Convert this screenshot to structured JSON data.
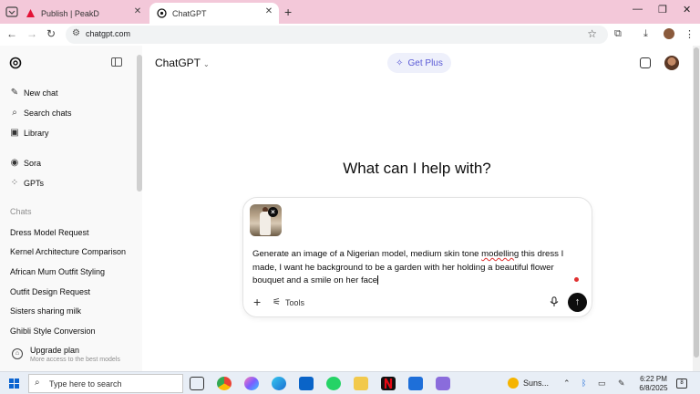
{
  "browser": {
    "tabs": [
      {
        "label": "Publish | PeakD",
        "icon": "peakd-icon"
      },
      {
        "label": "ChatGPT",
        "icon": "openai-icon",
        "active": true
      }
    ],
    "new_tab": "+",
    "window_controls": {
      "minimize": "—",
      "restore": "❐",
      "close": "✕"
    },
    "url": "chatgpt.com"
  },
  "sidebar": {
    "items": [
      {
        "label": "New chat",
        "icon": "edit-icon"
      },
      {
        "label": "Search chats",
        "icon": "search-icon"
      },
      {
        "label": "Library",
        "icon": "library-icon"
      },
      {
        "label": "Sora",
        "icon": "sora-icon"
      },
      {
        "label": "GPTs",
        "icon": "grid-icon"
      }
    ],
    "chats_header": "Chats",
    "chats": [
      "Dress Model Request",
      "Kernel Architecture Comparison",
      "African Mum Outfit Styling",
      "Outfit Design Request",
      "Sisters sharing milk",
      "Ghibli Style Conversion"
    ],
    "upgrade": {
      "title": "Upgrade plan",
      "subtitle": "More access to the best models"
    }
  },
  "header": {
    "model": "ChatGPT",
    "get_plus": "Get Plus"
  },
  "main": {
    "headline": "What can I help with?",
    "composer": {
      "prompt_before": "Generate an image of a Nigerian model, medium skin tone ",
      "prompt_misspelled": "modelling",
      "prompt_after": " this dress I made, I want he background to be a garden with her holding a beautiful flower bouquet and a smile on her face",
      "tools_label": "Tools"
    }
  },
  "taskbar": {
    "search_placeholder": "Type here to search",
    "weather": "Suns...",
    "time": "6:22 PM",
    "date": "6/8/2025",
    "notifications": "8"
  }
}
